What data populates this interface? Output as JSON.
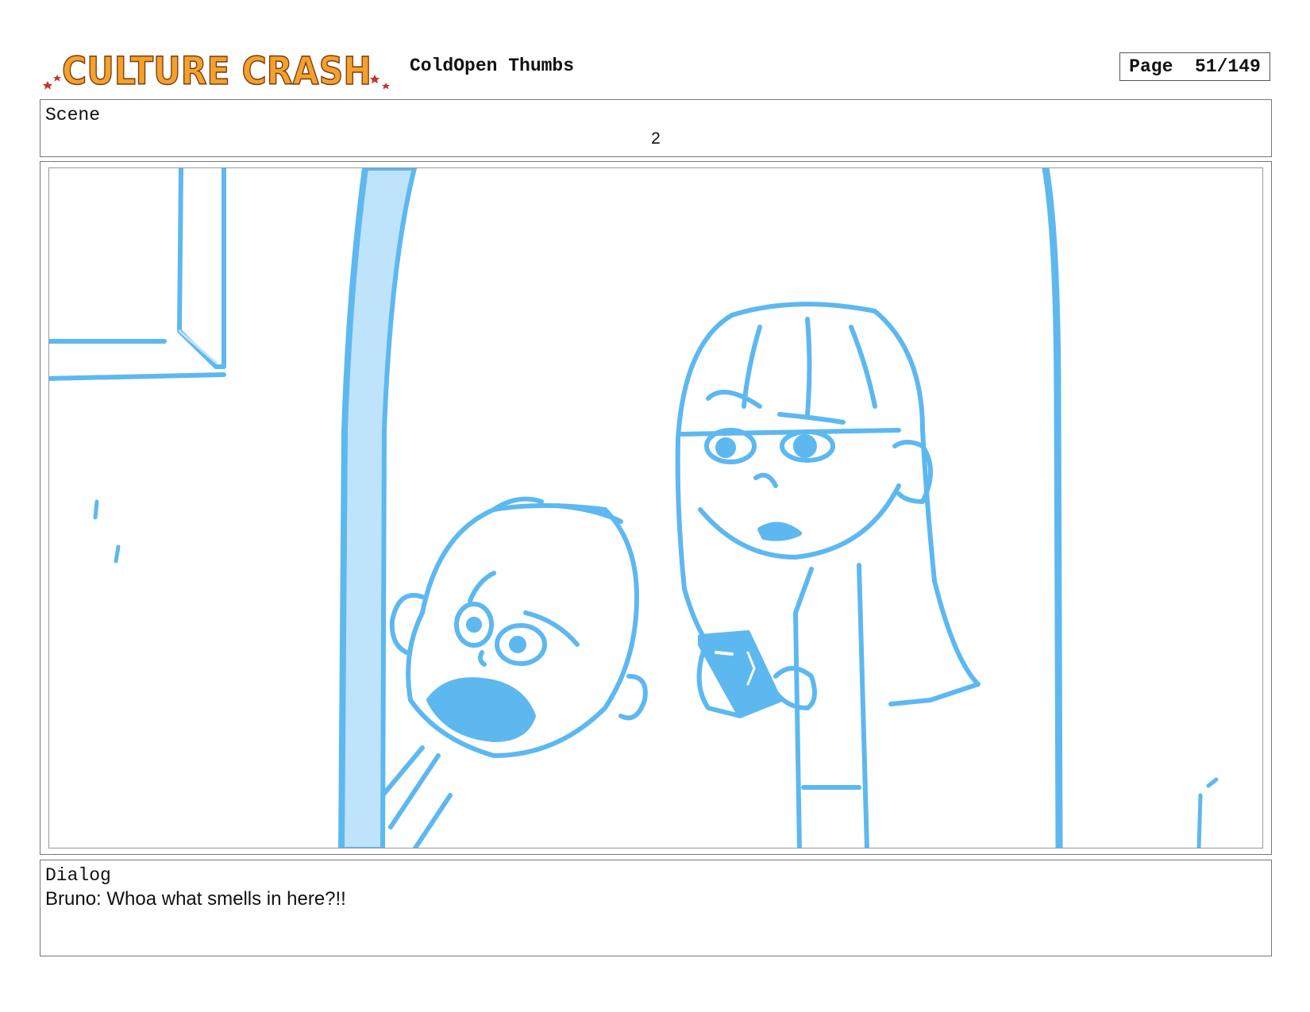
{
  "header": {
    "logo_text": "CULTURE CRASH",
    "doc_title": "ColdOpen Thumbs",
    "page_label": "Page",
    "page_value": "51/149"
  },
  "scene": {
    "label": "Scene",
    "number": "2"
  },
  "panel": {
    "sketch_color": "#5db8f0",
    "fill_color": "#bfe3fb"
  },
  "dialog": {
    "label": "Dialog",
    "text": "Bruno: Whoa what smells in here?!!"
  },
  "colors": {
    "logo_orange": "#f2a12c",
    "logo_red": "#e8502a",
    "star": "#c0392b"
  }
}
